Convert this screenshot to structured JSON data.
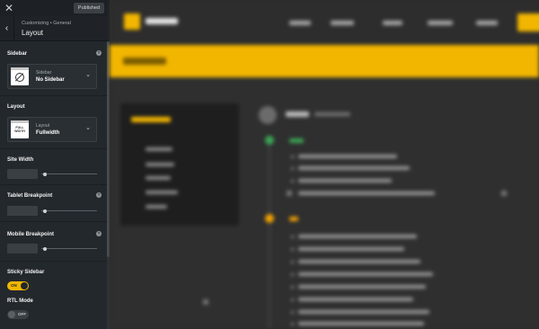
{
  "topbar": {
    "close_icon": "close-icon",
    "publish_label": "Published"
  },
  "header": {
    "back_icon": "chevron-left-icon",
    "breadcrumb": "Customizing • General",
    "title": "Layout"
  },
  "sidebar_section": {
    "label": "Sidebar",
    "help_icon": "help-icon",
    "selected_sub": "Sidebar",
    "selected_value": "No Sidebar"
  },
  "layout_section": {
    "label": "Layout",
    "selected_sub": "Layout",
    "selected_value": "Fullwidth",
    "thumb_text": "FULL WIDTH"
  },
  "site_width": {
    "label": "Site Width"
  },
  "tablet_breakpoint": {
    "label": "Tablet Breakpoint"
  },
  "mobile_breakpoint": {
    "label": "Mobile Breakpoint"
  },
  "sticky_sidebar": {
    "label": "Sticky Sidebar",
    "toggle_text": "ON",
    "state": "on"
  },
  "rtl_mode": {
    "label": "RTL Mode",
    "toggle_text": "OFF",
    "state": "off"
  },
  "colors": {
    "accent": "#f2b600",
    "sidebar_bg": "#23282d"
  }
}
